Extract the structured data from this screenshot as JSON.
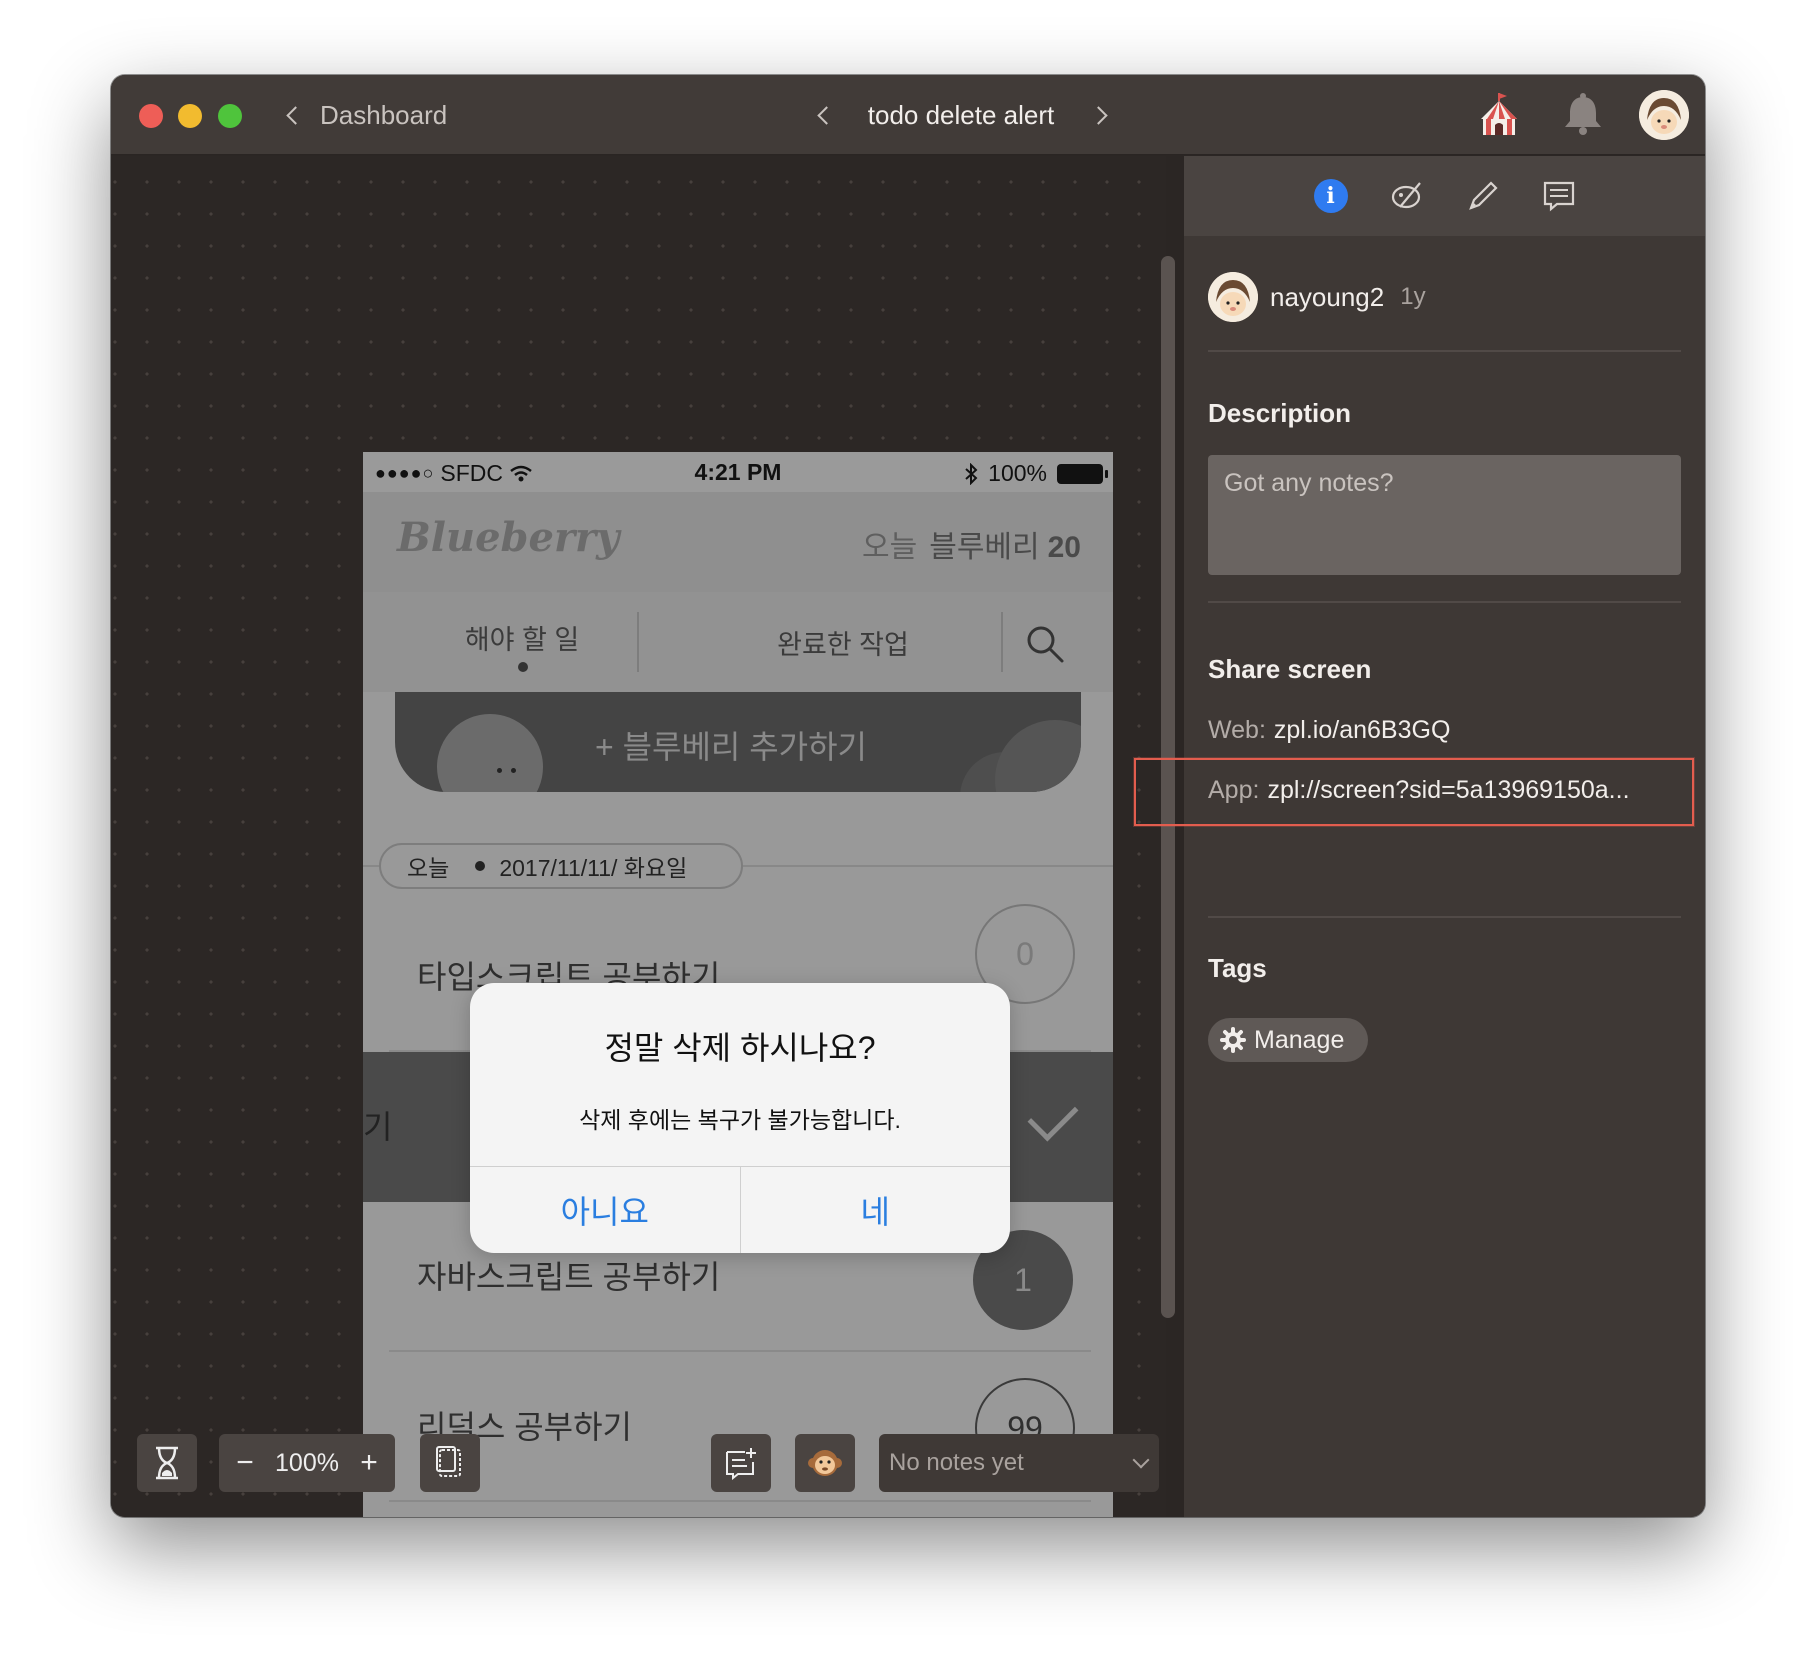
{
  "titlebar": {
    "back_label": "Dashboard",
    "screen_title": "todo delete alert"
  },
  "phone": {
    "status": {
      "carrier": "SFDC",
      "signal_dots": "●●●●○",
      "time": "4:21 PM",
      "battery": "100%"
    },
    "app": {
      "logo": "Blueberry",
      "today_label": "오늘",
      "count_label": "블루베리",
      "count_value": "20"
    },
    "tabs": [
      "해야 할 일",
      "완료한 작업"
    ],
    "add_button": "+ 블루베리 추가하기",
    "date": {
      "label": "오늘",
      "value": "2017/11/11/ 화요일"
    },
    "todos": [
      {
        "label": "타입스크립트 공부하기",
        "count": "0"
      },
      {
        "label": "기"
      },
      {
        "label": "자바스크립트 공부하기",
        "count": "1"
      },
      {
        "label": "리덕스 공부하기",
        "count": "99"
      }
    ],
    "alert": {
      "title": "정말 삭제 하시나요?",
      "message": "삭제 후에는 복구가 불가능합니다.",
      "cancel": "아니요",
      "confirm": "네"
    }
  },
  "toolbar": {
    "zoom": "100%",
    "zoom_out": "−",
    "zoom_in": "+",
    "notes": "No notes yet"
  },
  "panel": {
    "user": "nayoung2",
    "time": "1y",
    "description_heading": "Description",
    "description_placeholder": "Got any notes?",
    "share_heading": "Share screen",
    "web_label": "Web:",
    "web_url": "zpl.io/an6B3GQ",
    "app_label": "App:",
    "app_url": "zpl://screen?sid=5a13969150a...",
    "tags_heading": "Tags",
    "manage_label": "Manage"
  },
  "colors": {
    "accent_blue": "#2f7bf0",
    "ios_blue": "#2a7ee0",
    "highlight_red": "#e35d4e"
  }
}
